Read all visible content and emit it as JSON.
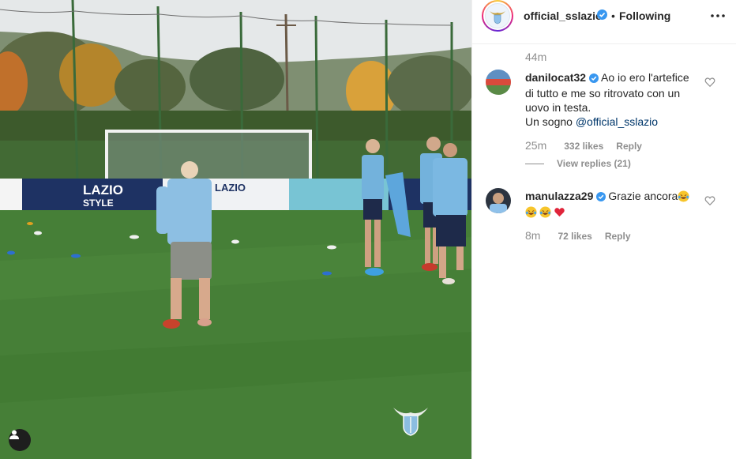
{
  "post": {
    "account": "official_sslazio",
    "follow_state": "Following",
    "separator": "•"
  },
  "icons": {
    "more": "more-options-icon",
    "verified": "verified-badge-icon",
    "like": "heart-outline-icon",
    "account": "user-silhouette-icon"
  },
  "colors": {
    "verified": "#3897f0",
    "link": "#00376b",
    "muted": "#8e8e8e",
    "lazio_sky": "#8fc1ea"
  },
  "caption_time": "44m",
  "comments": [
    {
      "username": "danilocat32",
      "verified": true,
      "text_line1": "Ao io ero l'artefice",
      "text_line2": "di tutto e me so ritrovato con un",
      "text_line3": "uovo in testa.",
      "text_line4_prefix": "Un sogno ",
      "mention": "@official_sslazio",
      "time": "25m",
      "likes": "332 likes",
      "reply": "Reply",
      "view_replies": "View replies (21)"
    },
    {
      "username": "manulazza29",
      "verified": true,
      "text": "Grazie ancora",
      "time": "8m",
      "likes": "72 likes",
      "reply": "Reply"
    }
  ],
  "media": {
    "ad_board_1": "LAZIO",
    "ad_board_1b": "STYLE",
    "ad_board_2": "LAZIO"
  }
}
